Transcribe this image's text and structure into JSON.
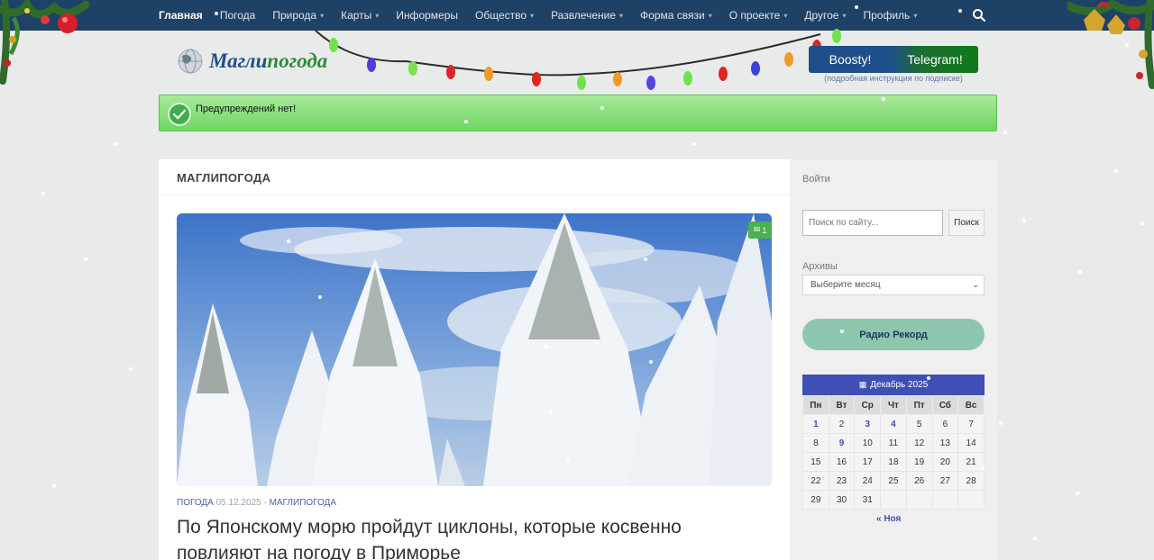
{
  "nav": {
    "items": [
      {
        "label": "Главная",
        "has_caret": false,
        "active": true
      },
      {
        "label": "Погода",
        "has_caret": false,
        "active": false
      },
      {
        "label": "Природа",
        "has_caret": true,
        "active": false
      },
      {
        "label": "Карты",
        "has_caret": true,
        "active": false
      },
      {
        "label": "Информеры",
        "has_caret": false,
        "active": false
      },
      {
        "label": "Общество",
        "has_caret": true,
        "active": false
      },
      {
        "label": "Развлечение",
        "has_caret": true,
        "active": false
      },
      {
        "label": "Форма связи",
        "has_caret": true,
        "active": false
      },
      {
        "label": "О проекте",
        "has_caret": true,
        "active": false
      },
      {
        "label": "Другое",
        "has_caret": true,
        "active": false
      },
      {
        "label": "Профиль",
        "has_caret": true,
        "active": false
      }
    ],
    "search_icon": "search-icon"
  },
  "header": {
    "logo_main": "Магли",
    "logo_accent": "погода",
    "boosty_label": "Boosty!",
    "telegram_label": "Telegram!",
    "subscribe_note": "(подробная инструкция по подписке)"
  },
  "alert": {
    "text": "Предупреждений нет!",
    "icon": "check-icon"
  },
  "main": {
    "section_title": "МАГЛИПОГОДА",
    "comment_count": "1",
    "post": {
      "category": "ПОГОДА",
      "date": "05.12.2025",
      "separator": "-",
      "category2": "МАГЛИПОГОДА",
      "title": "По Японскому морю пройдут циклоны, которые косвенно повлияют на погоду в Приморье"
    }
  },
  "sidebar": {
    "login": "Войти",
    "search_placeholder": "Поиск по сайту...",
    "search_button": "Поиск",
    "archives_label": "Архивы",
    "archives_selected": "Выберите месяц",
    "radio_button": "Радио Рекорд",
    "calendar": {
      "title": "Декабрь 2025",
      "weekdays": [
        "Пн",
        "Вт",
        "Ср",
        "Чт",
        "Пт",
        "Сб",
        "Вс"
      ],
      "weeks": [
        [
          "1",
          "2",
          "3",
          "4",
          "5",
          "6",
          "7"
        ],
        [
          "8",
          "9",
          "10",
          "11",
          "12",
          "13",
          "14"
        ],
        [
          "15",
          "16",
          "17",
          "18",
          "19",
          "20",
          "21"
        ],
        [
          "22",
          "23",
          "24",
          "25",
          "26",
          "27",
          "28"
        ],
        [
          "29",
          "30",
          "31",
          "",
          "",
          "",
          ""
        ]
      ],
      "linked_days": [
        "1",
        "3",
        "4",
        "9"
      ],
      "prev_link": "« Ноя"
    }
  },
  "colors": {
    "nav_bg": "#1e4166",
    "accent_blue": "#3f4fb5",
    "alert_green": "#6fd564",
    "radio_green": "#8ec6ad"
  }
}
